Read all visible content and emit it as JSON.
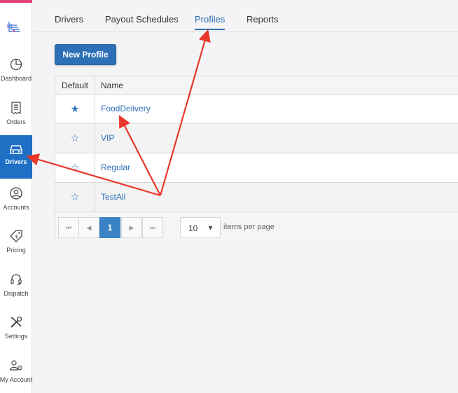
{
  "sidebar": {
    "items": [
      {
        "label": "Dashboard",
        "icon": "pie-chart-icon"
      },
      {
        "label": "Orders",
        "icon": "receipt-icon"
      },
      {
        "label": "Drivers",
        "icon": "car-icon",
        "active": true
      },
      {
        "label": "Accounts",
        "icon": "user-circle-icon"
      },
      {
        "label": "Pricing",
        "icon": "price-tag-icon"
      },
      {
        "label": "Dispatch",
        "icon": "headset-icon"
      },
      {
        "label": "Settings",
        "icon": "tools-icon"
      },
      {
        "label": "My Account",
        "icon": "user-gear-icon"
      }
    ]
  },
  "tabs": [
    {
      "label": "Drivers"
    },
    {
      "label": "Payout Schedules"
    },
    {
      "label": "Profiles",
      "active": true
    },
    {
      "label": "Reports"
    }
  ],
  "toolbar": {
    "new_profile_label": "New Profile"
  },
  "grid": {
    "columns": [
      "Default",
      "Name"
    ],
    "rows": [
      {
        "default": true,
        "star": "★",
        "name": "FoodDelivery"
      },
      {
        "default": false,
        "star": "☆",
        "name": "VIP"
      },
      {
        "default": false,
        "star": "☆",
        "name": "Regular"
      },
      {
        "default": false,
        "star": "☆",
        "name": "TestAll"
      }
    ]
  },
  "pager": {
    "first": "⏮",
    "prev": "◀",
    "current_page": "1",
    "next": "▶",
    "last": "⏭",
    "page_size": "10",
    "page_size_arrow": "▼",
    "items_per_page_label": "items per page"
  },
  "colors": {
    "accent": "#2d70b8",
    "sidebar_active": "#1f6fc5",
    "top_bar": "#e7417a",
    "annotation": "#e8372b"
  }
}
